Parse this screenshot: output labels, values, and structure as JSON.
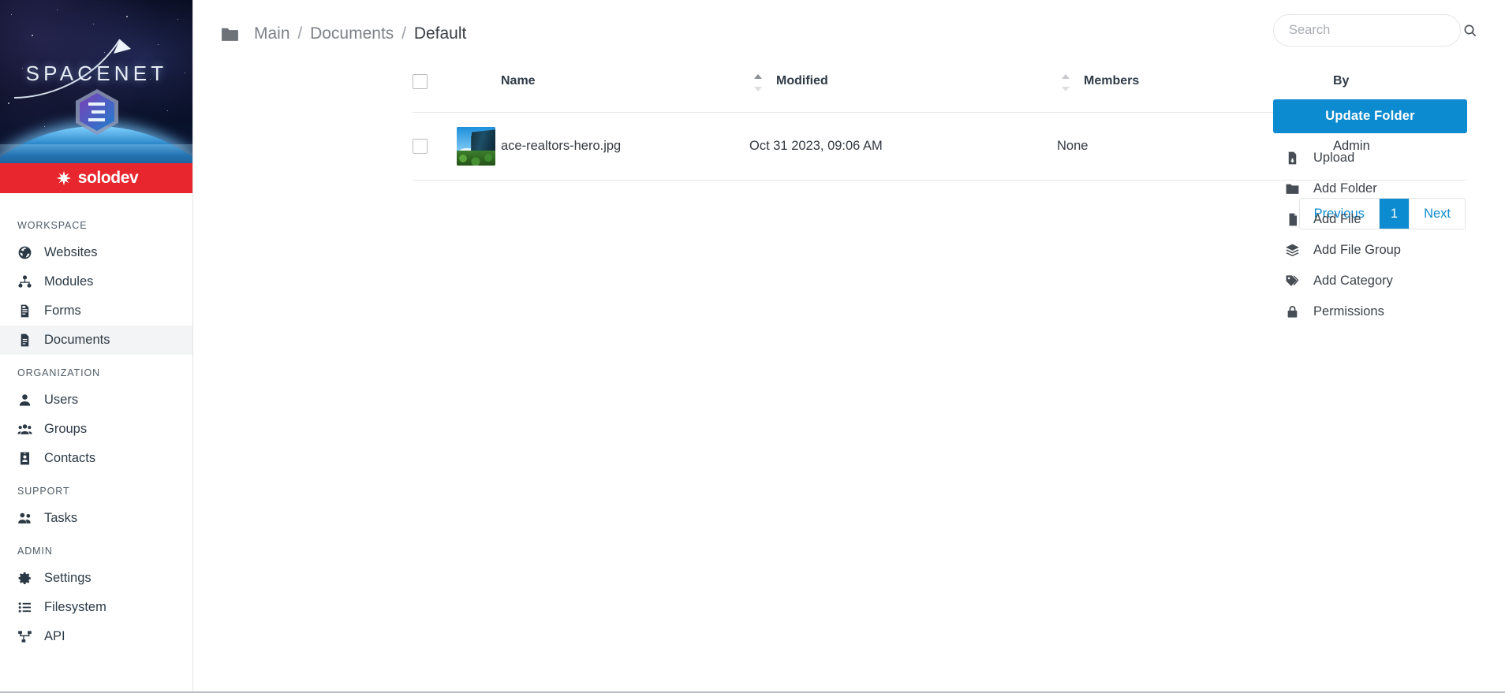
{
  "brand": {
    "logo_title": "SPACENET",
    "logo_badge": "3",
    "footer_brand": "solodev",
    "footer_brand_mark": "solodev-asterisk-icon",
    "accent_blue": "#0d8bd0",
    "brand_red": "#e8262d"
  },
  "sidebar": {
    "sections": [
      {
        "label": "WORKSPACE",
        "items": [
          {
            "label": "Websites",
            "icon": "globe-icon",
            "active": false
          },
          {
            "label": "Modules",
            "icon": "modules-icon",
            "active": false
          },
          {
            "label": "Forms",
            "icon": "form-icon",
            "active": false
          },
          {
            "label": "Documents",
            "icon": "document-icon",
            "active": true
          }
        ]
      },
      {
        "label": "ORGANIZATION",
        "items": [
          {
            "label": "Users",
            "icon": "user-icon",
            "active": false
          },
          {
            "label": "Groups",
            "icon": "users-group-icon",
            "active": false
          },
          {
            "label": "Contacts",
            "icon": "contact-card-icon",
            "active": false
          }
        ]
      },
      {
        "label": "SUPPORT",
        "items": [
          {
            "label": "Tasks",
            "icon": "tasks-users-icon",
            "active": false
          }
        ]
      },
      {
        "label": "ADMIN",
        "items": [
          {
            "label": "Settings",
            "icon": "gear-icon",
            "active": false
          },
          {
            "label": "Filesystem",
            "icon": "list-icon",
            "active": false
          },
          {
            "label": "API",
            "icon": "sitemap-icon",
            "active": false
          }
        ]
      }
    ]
  },
  "header": {
    "folder_icon": "folder-icon",
    "breadcrumb": [
      {
        "label": "Main",
        "current": false
      },
      {
        "label": "Documents",
        "current": false
      },
      {
        "label": "Default",
        "current": true
      }
    ],
    "breadcrumb_separator": "/"
  },
  "search": {
    "placeholder": "Search",
    "value": "",
    "icon": "search-icon"
  },
  "table": {
    "select_all_checked": false,
    "columns": [
      {
        "key": "check",
        "label": "",
        "sortable": false
      },
      {
        "key": "thumb",
        "label": "",
        "sortable": false
      },
      {
        "key": "name",
        "label": "Name",
        "sortable": true,
        "sort_active": true,
        "sort_dir": "asc"
      },
      {
        "key": "modified",
        "label": "Modified",
        "sortable": true,
        "sort_active": false
      },
      {
        "key": "members",
        "label": "Members",
        "sortable": false
      },
      {
        "key": "by",
        "label": "By",
        "sortable": false
      }
    ],
    "rows": [
      {
        "checked": false,
        "thumbnail": "office-building-photo-thumbnail",
        "name": "ace-realtors-hero.jpg",
        "modified": "Oct 31 2023, 09:06 AM",
        "members": "None",
        "by": "Admin"
      }
    ]
  },
  "pagination": {
    "previous_label": "Previous",
    "next_label": "Next",
    "pages": [
      "1"
    ],
    "current_page": "1"
  },
  "actions": {
    "primary_label": "Update Folder",
    "items": [
      {
        "label": "Upload",
        "icon": "file-upload-icon"
      },
      {
        "label": "Add Folder",
        "icon": "folder-icon"
      },
      {
        "label": "Add File",
        "icon": "file-icon"
      },
      {
        "label": "Add File Group",
        "icon": "layers-icon"
      },
      {
        "label": "Add Category",
        "icon": "tag-icon"
      },
      {
        "label": "Permissions",
        "icon": "lock-icon"
      }
    ]
  }
}
